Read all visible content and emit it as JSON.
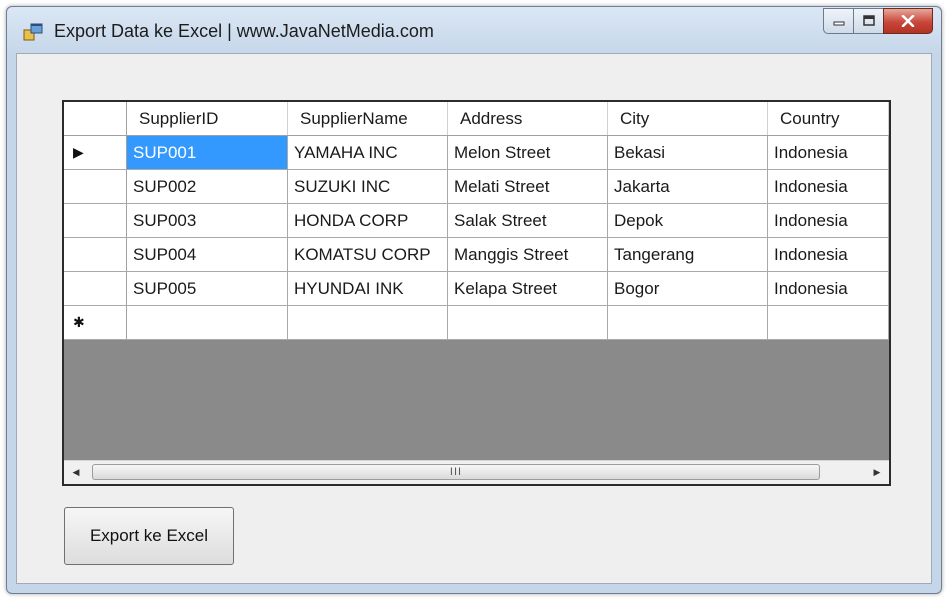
{
  "window": {
    "title": "Export Data ke Excel | www.JavaNetMedia.com",
    "icons": {
      "app": "winforms-app-icon",
      "minimize": "minimize-icon",
      "maximize": "maximize-icon",
      "close": "close-icon"
    }
  },
  "grid": {
    "columns": [
      "SupplierID",
      "SupplierName",
      "Address",
      "City",
      "Country"
    ],
    "current_row_marker": "▶",
    "new_row_marker": "✱",
    "rows": [
      [
        "SUP001",
        "YAMAHA INC",
        "Melon Street",
        "Bekasi",
        "Indonesia"
      ],
      [
        "SUP002",
        "SUZUKI INC",
        "Melati Street",
        "Jakarta",
        "Indonesia"
      ],
      [
        "SUP003",
        "HONDA CORP",
        "Salak Street",
        "Depok",
        "Indonesia"
      ],
      [
        "SUP004",
        "KOMATSU CORP",
        "Manggis Street",
        "Tangerang",
        "Indonesia"
      ],
      [
        "SUP005",
        "HYUNDAI INK",
        "Kelapa Street",
        "Bogor",
        "Indonesia"
      ]
    ],
    "scrollbar": {
      "grip": "III"
    }
  },
  "actions": {
    "export_label": "Export ke Excel"
  },
  "colors": {
    "selection": "#3399ff",
    "grid_background": "#8a8a8a"
  }
}
